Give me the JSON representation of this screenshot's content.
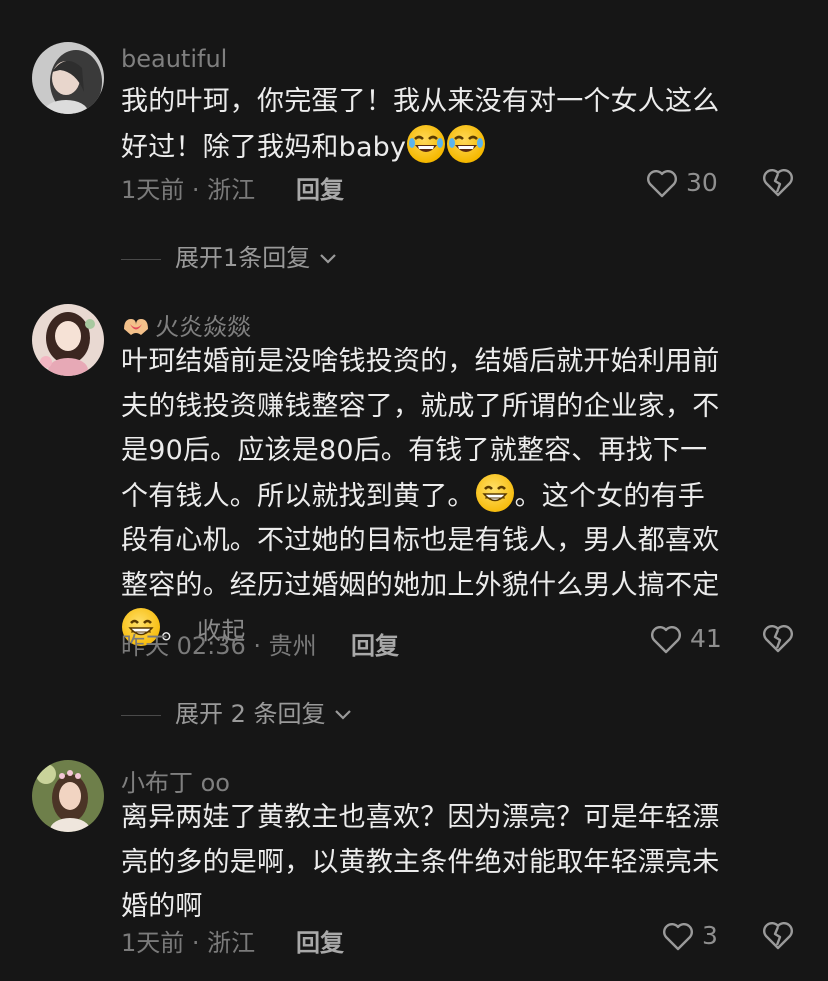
{
  "comments": [
    {
      "username": "beautiful",
      "lines": [
        "我的叶珂，你完蛋了！我从来没有对一个女人这么",
        "好过！除了我妈和baby"
      ],
      "meta": "1天前 · 浙江",
      "reply_label": "回复",
      "likes": "30",
      "expand_label": "展开1条回复"
    },
    {
      "username": "火炎焱燚",
      "lines": [
        "叶珂结婚前是没啥钱投资的，结婚后就开始利用前",
        "夫的钱投资赚钱整容了，就成了所谓的企业家，不",
        "是90后。应该是80后。有钱了就整容、再找下一",
        "个有钱人。所以就找到黄了。",
        "。这个女的有手",
        "段有心机。不过她的目标也是有钱人，男人都喜欢",
        "整容的。经历过婚姻的她加上外貌什么男人搞不定",
        "。"
      ],
      "collapse_label": "收起",
      "meta": "昨天 02:36 · 贵州",
      "reply_label": "回复",
      "likes": "41",
      "expand_label": "展开 2 条回复"
    },
    {
      "username": "小布丁 oo",
      "lines": [
        "离异两娃了黄教主也喜欢？因为漂亮？可是年轻漂",
        "亮的多的是啊，以黄教主条件绝对能取年轻漂亮未",
        "婚的啊"
      ],
      "meta": "1天前 · 浙江",
      "reply_label": "回复",
      "likes": "3"
    }
  ],
  "icons": {
    "like": "heart-outline-icon",
    "dislike": "broken-heart-icon",
    "expand": "chevron-down-icon",
    "laugh_emoji": "rolling-laughing-emoji",
    "grin_emoji": "grinning-emoji",
    "badge": "heart-hands-icon"
  }
}
